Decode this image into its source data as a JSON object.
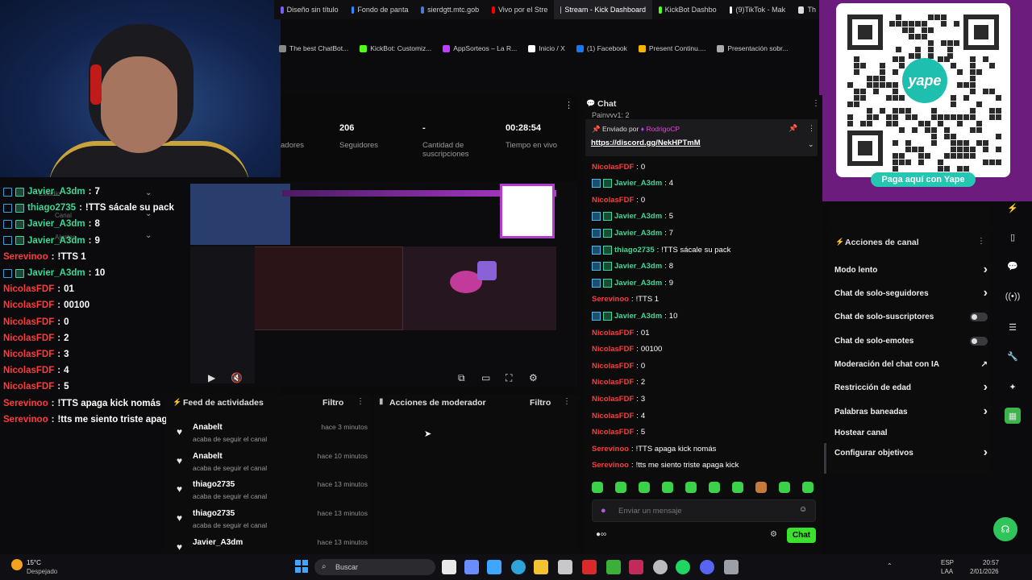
{
  "browser": {
    "tabs": [
      {
        "label": "Diseño sin título",
        "color": "#7b5cff"
      },
      {
        "label": "Fondo de panta",
        "color": "#2f8cff"
      },
      {
        "label": "sierdgtt.mtc.gob",
        "color": "#4a7bd0"
      },
      {
        "label": "Vivo por el Stre",
        "color": "#ff0000"
      },
      {
        "label": "Stream - Kick Dashboard",
        "color": "#53fc18",
        "active": true
      },
      {
        "label": "KickBot Dashbo",
        "color": "#53fc18"
      },
      {
        "label": "(9)TikTok - Mak",
        "color": "#ffffff"
      },
      {
        "label": "Th",
        "color": "#dddddd"
      }
    ],
    "bookmarks": [
      {
        "label": "The best ChatBot...",
        "color": "#888"
      },
      {
        "label": "KickBot: Customiz...",
        "color": "#53fc18"
      },
      {
        "label": "AppSorteos – La R...",
        "color": "#c13cff"
      },
      {
        "label": "Inicio / X",
        "color": "#ffffff"
      },
      {
        "label": "(1) Facebook",
        "color": "#1877f2"
      },
      {
        "label": "Present Continu....",
        "color": "#f4b400"
      },
      {
        "label": "Presentación sobr...",
        "color": "#aaa"
      }
    ]
  },
  "qr": {
    "brand": "yape",
    "button": "Paga aquí con Yape"
  },
  "overlay_chat": [
    {
      "user": "Javier_A3dm",
      "msg": "7",
      "color": "#3cd896",
      "badge": true
    },
    {
      "user": "thiago2735",
      "msg": "!TTS sácale su pack",
      "color": "#3cd896",
      "badge": true
    },
    {
      "user": "Javier_A3dm",
      "msg": "8",
      "color": "#3cd896",
      "badge": true
    },
    {
      "user": "Javier_A3dm",
      "msg": "9",
      "color": "#3cd896",
      "badge": true
    },
    {
      "user": "Serevinoo",
      "msg": "!TTS 1",
      "color": "#ff3b3b",
      "badge": false
    },
    {
      "user": "Javier_A3dm",
      "msg": "10",
      "color": "#3cd896",
      "badge": true
    },
    {
      "user": "NicolasFDF",
      "msg": "01",
      "color": "#ff3b3b",
      "badge": false
    },
    {
      "user": "NicolasFDF",
      "msg": "00100",
      "color": "#ff3b3b",
      "badge": false
    },
    {
      "user": "NicolasFDF",
      "msg": "0",
      "color": "#ff3b3b",
      "badge": false
    },
    {
      "user": "NicolasFDF",
      "msg": "2",
      "color": "#ff3b3b",
      "badge": false
    },
    {
      "user": "NicolasFDF",
      "msg": "3",
      "color": "#ff3b3b",
      "badge": false
    },
    {
      "user": "NicolasFDF",
      "msg": "4",
      "color": "#ff3b3b",
      "badge": false
    },
    {
      "user": "NicolasFDF",
      "msg": "5",
      "color": "#ff3b3b",
      "badge": false
    },
    {
      "user": "Serevinoo",
      "msg": "!TTS apaga kick nomás",
      "color": "#ff3b3b",
      "badge": false
    },
    {
      "user": "Serevinoo",
      "msg": "!tts me siento triste apaga kick",
      "color": "#ff3b3b",
      "badge": false
    }
  ],
  "sidebar_ghost": {
    "estudio": "Estudio",
    "canal": "Canal",
    "ajustes": "Ajustes"
  },
  "stats": [
    {
      "num": "",
      "label": "adores"
    },
    {
      "num": "206",
      "label": "Seguidores"
    },
    {
      "num": "-",
      "label": "Cantidad de suscripciones"
    },
    {
      "num": "00:28:54",
      "label": "Tiempo en vivo"
    }
  ],
  "feed": {
    "title": "Feed de actividades",
    "filter": "Filtro",
    "items": [
      {
        "name": "Anabelt",
        "sub": "acaba de seguir el canal",
        "time": "hace 3 minutos"
      },
      {
        "name": "Anabelt",
        "sub": "acaba de seguir el canal",
        "time": "hace 10 minutos"
      },
      {
        "name": "thiago2735",
        "sub": "acaba de seguir el canal",
        "time": "hace 13 minutos"
      },
      {
        "name": "thiago2735",
        "sub": "acaba de seguir el canal",
        "time": "hace 13 minutos"
      },
      {
        "name": "Javier_A3dm",
        "sub": "",
        "time": "hace 13 minutos"
      }
    ]
  },
  "mod": {
    "title": "Acciones de moderador",
    "filter": "Filtro"
  },
  "chat": {
    "title": "Chat",
    "cut_line": "Painyyy1: 2",
    "pinned_by_label": "Enviado por",
    "pinned_user": "RodrigoCP",
    "pinned_link": "https://discord.gg/NekHPTmM",
    "messages": [
      {
        "user": "NicolasFDF",
        "msg": "0",
        "color": "#ff3b3b",
        "badge": false
      },
      {
        "user": "Javier_A3dm",
        "msg": "4",
        "color": "#3cd896",
        "badge": true
      },
      {
        "user": "NicolasFDF",
        "msg": "0",
        "color": "#ff3b3b",
        "badge": false
      },
      {
        "user": "Javier_A3dm",
        "msg": "5",
        "color": "#3cd896",
        "badge": true
      },
      {
        "user": "Javier_A3dm",
        "msg": "7",
        "color": "#3cd896",
        "badge": true
      },
      {
        "user": "thiago2735",
        "msg": "!TTS sácale su pack",
        "color": "#3cd896",
        "badge": true
      },
      {
        "user": "Javier_A3dm",
        "msg": "8",
        "color": "#3cd896",
        "badge": true
      },
      {
        "user": "Javier_A3dm",
        "msg": "9",
        "color": "#3cd896",
        "badge": true
      },
      {
        "user": "Serevinoo",
        "msg": "!TTS 1",
        "color": "#ff3b3b",
        "badge": false
      },
      {
        "user": "Javier_A3dm",
        "msg": "10",
        "color": "#3cd896",
        "badge": true
      },
      {
        "user": "NicolasFDF",
        "msg": "01",
        "color": "#ff3b3b",
        "badge": false
      },
      {
        "user": "NicolasFDF",
        "msg": "00100",
        "color": "#ff3b3b",
        "badge": false
      },
      {
        "user": "NicolasFDF",
        "msg": "0",
        "color": "#ff3b3b",
        "badge": false
      },
      {
        "user": "NicolasFDF",
        "msg": "2",
        "color": "#ff3b3b",
        "badge": false
      },
      {
        "user": "NicolasFDF",
        "msg": "3",
        "color": "#ff3b3b",
        "badge": false
      },
      {
        "user": "NicolasFDF",
        "msg": "4",
        "color": "#ff3b3b",
        "badge": false
      },
      {
        "user": "NicolasFDF",
        "msg": "5",
        "color": "#ff3b3b",
        "badge": false
      },
      {
        "user": "Serevinoo",
        "msg": "!TTS apaga kick nomás",
        "color": "#ff3b3b",
        "badge": false
      },
      {
        "user": "Serevinoo",
        "msg": "!tts me siento triste apaga kick",
        "color": "#ff3b3b",
        "badge": false
      }
    ],
    "placeholder": "Enviar un mensaje",
    "send": "Chat"
  },
  "channel_actions": {
    "title": "Acciones de canal",
    "items": [
      {
        "label": "Modo lento",
        "control": "chevron"
      },
      {
        "label": "Chat de solo-seguidores",
        "control": "chevron"
      },
      {
        "label": "Chat de solo-suscriptores",
        "control": "toggle"
      },
      {
        "label": "Chat de solo-emotes",
        "control": "toggle"
      },
      {
        "label": "Moderación del chat con IA",
        "control": "external"
      },
      {
        "label": "Restricción de edad",
        "control": "chevron"
      },
      {
        "label": "Palabras baneadas",
        "control": "chevron"
      },
      {
        "label": "Hostear canal",
        "control": "none"
      },
      {
        "label": "Configurar objetivos",
        "control": "chevron"
      }
    ]
  },
  "taskbar": {
    "weather_temp": "15°C",
    "weather_desc": "Despejado",
    "search": "Buscar",
    "lang1": "ESP",
    "lang2": "LAA",
    "time": "20:57",
    "date": "2/01/2026"
  }
}
